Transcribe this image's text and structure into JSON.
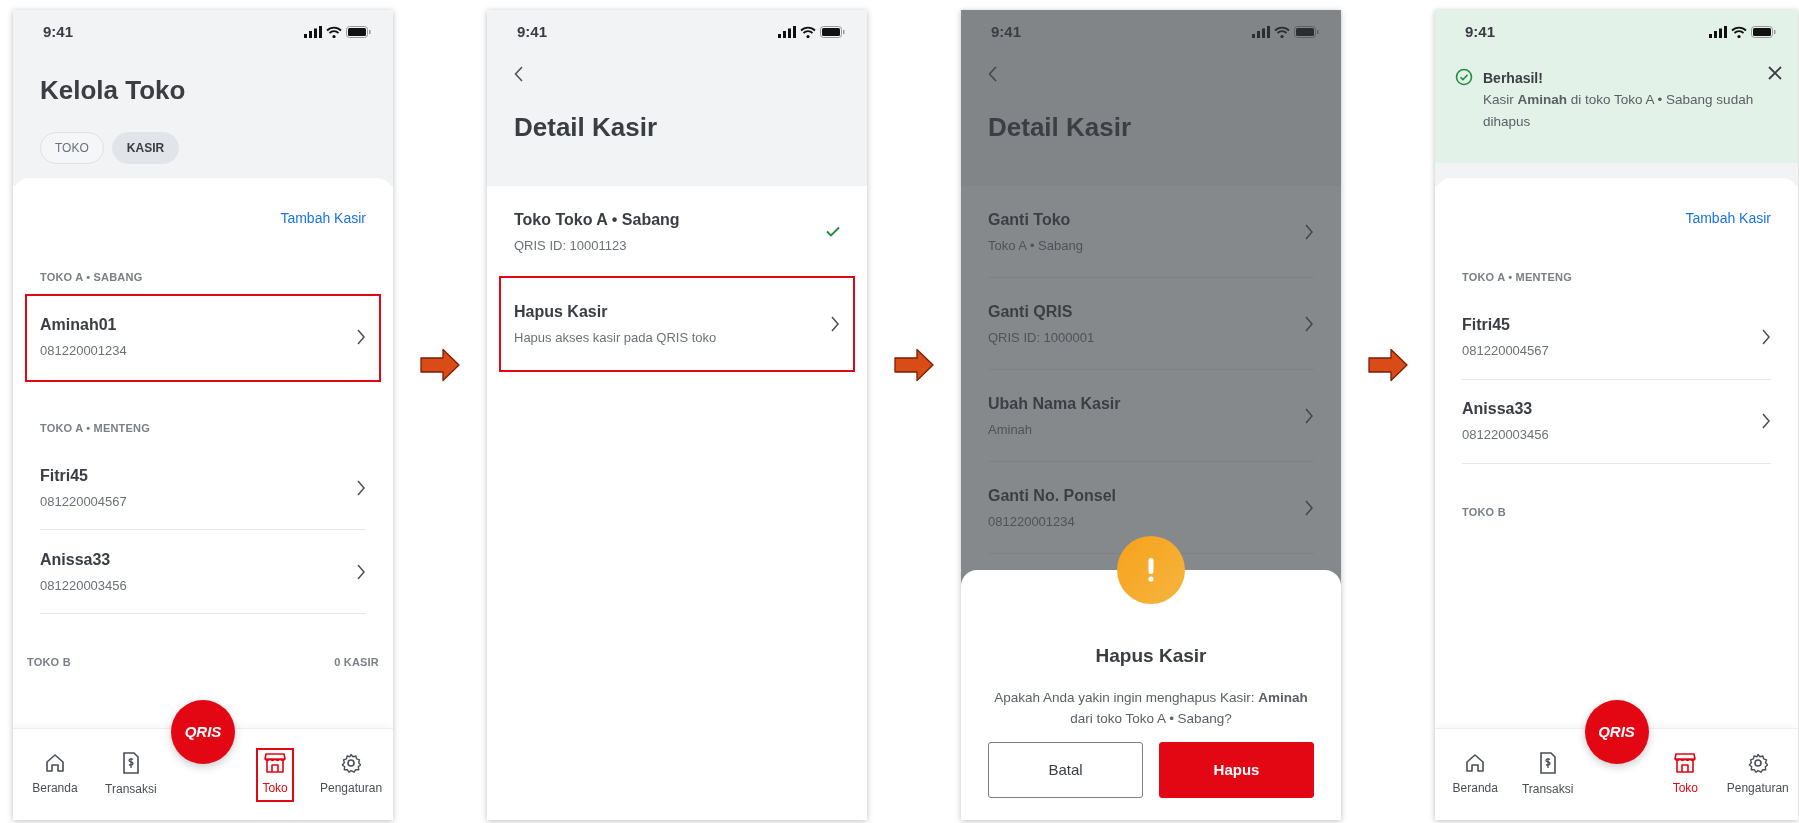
{
  "screens": [
    {
      "kind": "list",
      "time": "9:41",
      "title": "Kelola Toko",
      "tabs": [
        {
          "label": "TOKO",
          "selected": false
        },
        {
          "label": "KASIR",
          "selected": true
        }
      ],
      "action": "Tambah Kasir",
      "groups": [
        {
          "name": "TOKO A • SABANG",
          "items": [
            {
              "name": "Aminah01",
              "phone": "081220001234",
              "highlighted": true
            }
          ]
        },
        {
          "name": "TOKO A • MENTENG",
          "items": [
            {
              "name": "Fitri45",
              "phone": "081220004567",
              "highlighted": false
            },
            {
              "name": "Anissa33",
              "phone": "081220003456",
              "highlighted": false
            }
          ]
        },
        {
          "name": "TOKO B",
          "count": "0 KASIR"
        }
      ],
      "fab": "QRIS",
      "nav": [
        {
          "label": "Beranda",
          "selected": false,
          "highlighted": false
        },
        {
          "label": "Transaksi",
          "selected": false,
          "highlighted": false
        },
        {
          "label": "Toko",
          "selected": true,
          "highlighted": true
        },
        {
          "label": "Pengaturan",
          "selected": false,
          "highlighted": false
        }
      ]
    },
    {
      "kind": "detail",
      "time": "9:41",
      "title": "Detail Kasir",
      "rows": [
        {
          "title": "Toko Toko A • Sabang",
          "subtitle": "QRIS ID: 10001123",
          "kind": "check",
          "highlighted": false
        },
        {
          "title": "Hapus Kasir",
          "subtitle": "Hapus akses kasir pada QRIS toko",
          "kind": "chevron",
          "highlighted": true
        }
      ]
    },
    {
      "kind": "detail",
      "time": "9:41",
      "title": "Detail Kasir",
      "rows": [
        {
          "title": "Ganti Toko",
          "subtitle": "Toko A • Sabang",
          "kind": "chevron",
          "highlighted": false
        },
        {
          "title": "Ganti QRIS",
          "subtitle": "QRIS ID: 1000001",
          "kind": "chevron",
          "highlighted": false
        },
        {
          "title": "Ubah Nama Kasir",
          "subtitle": "Aminah",
          "kind": "chevron",
          "highlighted": false
        },
        {
          "title": "Ganti No. Ponsel",
          "subtitle": "081220001234",
          "kind": "chevron",
          "highlighted": false
        }
      ],
      "dialog": {
        "title": "Hapus Kasir",
        "message": "Apakah Anda yakin ingin menghapus Kasir: **Aminah** dari toko Toko A • Sabang?",
        "buttons": [
          {
            "label": "Batal",
            "kind": "outline"
          },
          {
            "label": "Hapus",
            "kind": "primary"
          }
        ]
      }
    },
    {
      "kind": "list",
      "time": "9:41",
      "toast": {
        "title": "Berhasil!",
        "message": "Kasir **Aminah** di toko Toko A • Sabang sudah dihapus"
      },
      "action": "Tambah Kasir",
      "groups": [
        {
          "name": "TOKO A • MENTENG",
          "items": [
            {
              "name": "Fitri45",
              "phone": "081220004567",
              "highlighted": false
            },
            {
              "name": "Anissa33",
              "phone": "081220003456",
              "highlighted": false
            }
          ]
        },
        {
          "name": "TOKO B"
        }
      ],
      "fab": "QRIS",
      "nav": [
        {
          "label": "Beranda",
          "selected": false,
          "highlighted": false
        },
        {
          "label": "Transaksi",
          "selected": false,
          "highlighted": false
        },
        {
          "label": "Toko",
          "selected": true,
          "highlighted": false
        },
        {
          "label": "Pengaturan",
          "selected": false,
          "highlighted": false
        }
      ]
    }
  ]
}
